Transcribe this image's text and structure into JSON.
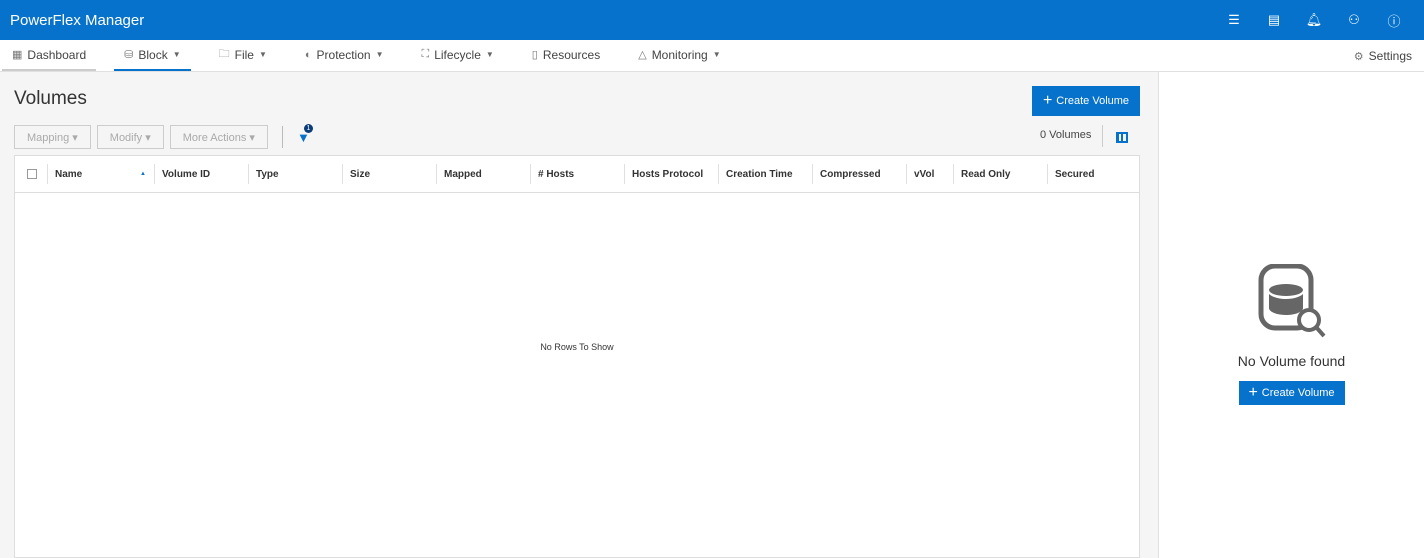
{
  "app": {
    "title": "PowerFlex Manager"
  },
  "header_icons": [
    "jobs-icon",
    "clipboard-icon",
    "bell-icon",
    "user-icon",
    "help-icon"
  ],
  "nav": {
    "items": [
      {
        "label": "Dashboard",
        "icon": "dashboard-icon"
      },
      {
        "label": "Block",
        "icon": "database-icon",
        "dropdown": true
      },
      {
        "label": "File",
        "icon": "folder-icon",
        "dropdown": true
      },
      {
        "label": "Protection",
        "icon": "shield-icon",
        "dropdown": true
      },
      {
        "label": "Lifecycle",
        "icon": "lifecycle-icon",
        "dropdown": true
      },
      {
        "label": "Resources",
        "icon": "resources-icon"
      },
      {
        "label": "Monitoring",
        "icon": "bell-icon",
        "dropdown": true
      }
    ],
    "settings": "Settings"
  },
  "page": {
    "title": "Volumes",
    "create_label": "Create Volume",
    "toolbar": {
      "mapping": "Mapping",
      "modify": "Modify",
      "more": "More Actions",
      "filter_count": "1"
    },
    "count": "0 Volumes"
  },
  "table": {
    "columns": [
      "Name",
      "Volume ID",
      "Type",
      "Size",
      "Mapped",
      "# Hosts",
      "Hosts Protocol",
      "Creation Time",
      "Compressed",
      "vVol",
      "Read Only",
      "Secured"
    ],
    "empty": "No Rows To Show"
  },
  "side": {
    "empty_title": "No Volume found",
    "create_label": "Create Volume"
  }
}
